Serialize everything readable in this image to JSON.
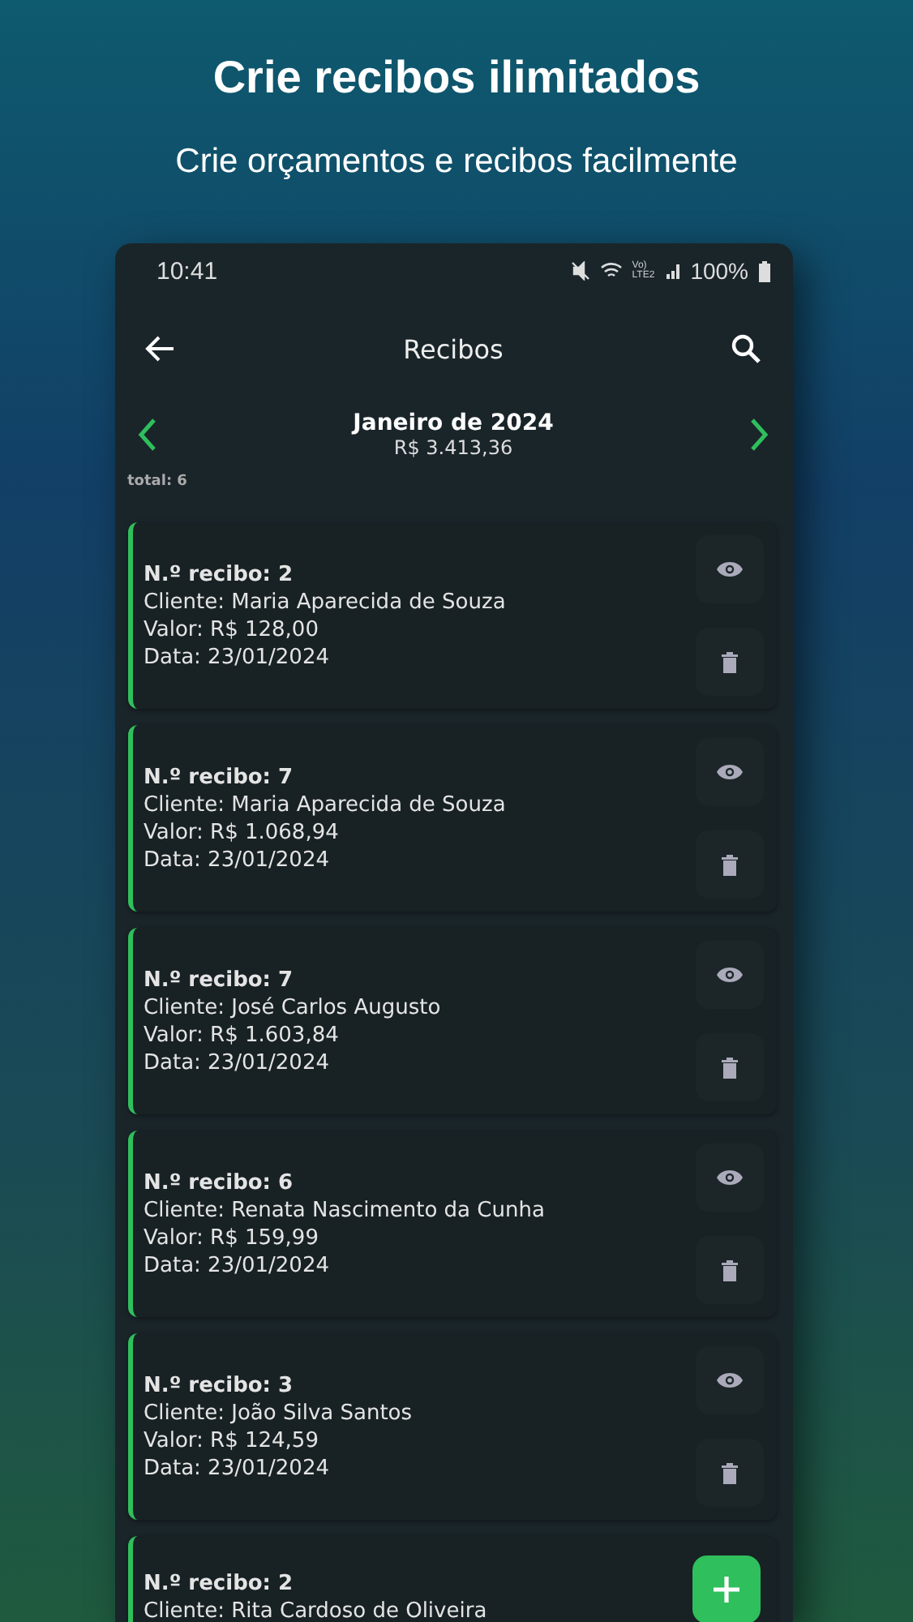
{
  "headline": "Crie recibos ilimitados",
  "subheadline": "Crie orçamentos e recibos facilmente",
  "status_bar": {
    "time": "10:41",
    "network": [
      "Vo)",
      "LTE2"
    ],
    "battery": "100%"
  },
  "app_bar": {
    "title": "Recibos"
  },
  "month": {
    "label": "Janeiro de 2024",
    "total": "R$ 3.413,36"
  },
  "count": "total: 6",
  "receipts": [
    {
      "kind": "full",
      "number": "N.º recibo: 2",
      "client": "Cliente: Maria Aparecida de Souza",
      "value": "Valor: R$ 128,00",
      "date": "Data: 23/01/2024"
    },
    {
      "kind": "full",
      "number": "N.º recibo: 7",
      "client": "Cliente: Maria Aparecida de Souza",
      "value": "Valor: R$ 1.068,94",
      "date": "Data: 23/01/2024"
    },
    {
      "kind": "full",
      "number": "N.º recibo: 7",
      "client": "Cliente: José Carlos Augusto",
      "value": "Valor: R$ 1.603,84",
      "date": "Data: 23/01/2024"
    },
    {
      "kind": "full",
      "number": "N.º recibo: 6",
      "client": "Cliente: Renata Nascimento da Cunha",
      "value": "Valor: R$ 159,99",
      "date": "Data: 23/01/2024"
    },
    {
      "kind": "full",
      "number": "N.º recibo: 3",
      "client": "Cliente: João Silva Santos",
      "value": "Valor: R$ 124,59",
      "date": "Data: 23/01/2024"
    },
    {
      "kind": "partial",
      "number": "N.º recibo: 2",
      "client": "Cliente: Rita Cardoso de Oliveira"
    }
  ]
}
